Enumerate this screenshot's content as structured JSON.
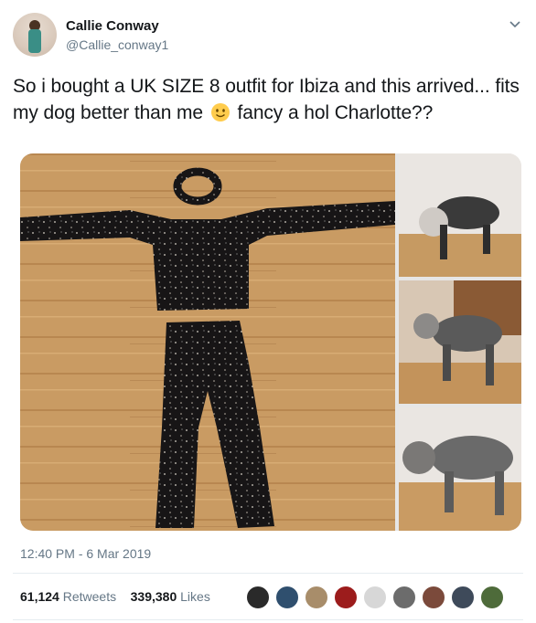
{
  "tweet": {
    "display_name": "Callie Conway",
    "handle": "@Callie_conway1",
    "text_part1": "So i bought a UK SIZE 8 outfit for Ibiza and this arrived... fits my dog better than me",
    "text_part2": "fancy a hol Charlotte??",
    "emoji": "slightly-smiling-face",
    "timestamp": "12:40 PM - 6 Mar 2019"
  },
  "stats": {
    "retweets_count": "61,124",
    "retweets_label": "Retweets",
    "likes_count": "339,380",
    "likes_label": "Likes"
  },
  "media": [
    {
      "name": "outfit-laid-out-photo",
      "icon": "photo"
    },
    {
      "name": "dog-in-outfit-photo-1",
      "icon": "photo"
    },
    {
      "name": "dog-in-outfit-photo-2",
      "icon": "photo"
    },
    {
      "name": "dog-in-outfit-photo-3",
      "icon": "photo"
    }
  ],
  "likers_count_shown": 9,
  "colors": {
    "text": "#14171a",
    "secondary": "#657786",
    "divider": "#e6ecf0",
    "link": "#1da1f2"
  }
}
